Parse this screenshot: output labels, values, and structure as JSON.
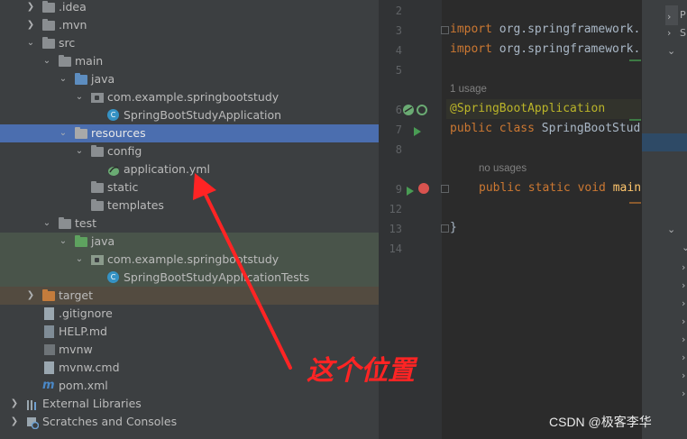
{
  "project_tree": {
    "items": [
      {
        "label": ".idea"
      },
      {
        "label": ".mvn"
      },
      {
        "label": "src"
      },
      {
        "label": "main"
      },
      {
        "label": "java"
      },
      {
        "label": "com.example.springbootstudy"
      },
      {
        "label": "SpringBootStudyApplication"
      },
      {
        "label": "resources"
      },
      {
        "label": "config"
      },
      {
        "label": "application.yml"
      },
      {
        "label": "static"
      },
      {
        "label": "templates"
      },
      {
        "label": "test"
      },
      {
        "label": "java"
      },
      {
        "label": "com.example.springbootstudy"
      },
      {
        "label": "SpringBootStudyApplicationTests"
      },
      {
        "label": "target"
      },
      {
        "label": ".gitignore"
      },
      {
        "label": "HELP.md"
      },
      {
        "label": "mvnw"
      },
      {
        "label": "mvnw.cmd"
      },
      {
        "label": "pom.xml"
      },
      {
        "label": "External Libraries"
      },
      {
        "label": "Scratches and Consoles"
      }
    ]
  },
  "editor": {
    "line_numbers": [
      "2",
      "3",
      "4",
      "5",
      "6",
      "7",
      "8",
      "9",
      "12",
      "13",
      "14"
    ],
    "imports": [
      "import",
      "org.springframework."
    ],
    "usage_hint": "1 usage",
    "annotation": "@SpringBootApplication",
    "class_line": {
      "kw": "public class",
      "name": "SpringBootStud"
    },
    "no_usages_hint": "no usages",
    "main_line": {
      "kw": "public static void",
      "name": "main"
    },
    "closing_brace": "}"
  },
  "right_panel": {
    "labels": [
      "P",
      "S"
    ]
  },
  "annotation_overlay": {
    "note": "这个位置",
    "color": "#ff2424"
  },
  "watermark": "CSDN @极客李华",
  "icons": {
    "folder": "folder-icon",
    "package": "package-icon",
    "class": "class-icon",
    "run": "run-gutter-icon",
    "breakpoint": "breakpoint-icon"
  }
}
